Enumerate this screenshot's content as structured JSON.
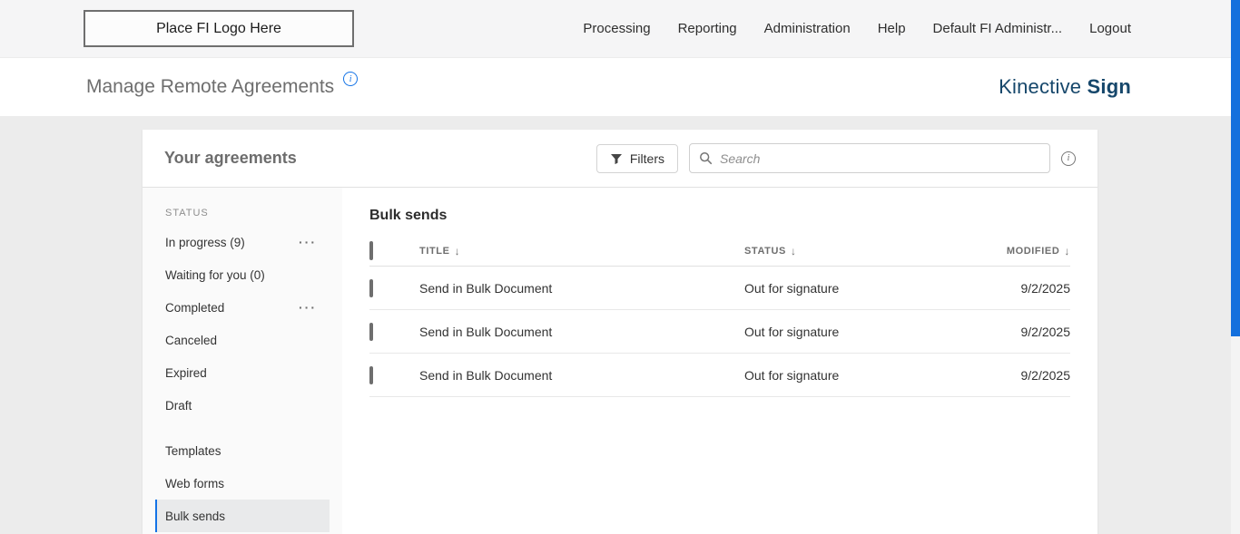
{
  "topnav": {
    "logo_placeholder": "Place FI Logo Here",
    "items": [
      {
        "label": "Processing"
      },
      {
        "label": "Reporting"
      },
      {
        "label": "Administration"
      },
      {
        "label": "Help"
      },
      {
        "label": "Default FI Administr..."
      },
      {
        "label": "Logout"
      }
    ]
  },
  "header": {
    "title": "Manage Remote Agreements",
    "brand": {
      "name": "Kinective",
      "product": "Sign"
    }
  },
  "card": {
    "title": "Your agreements",
    "filters_label": "Filters",
    "search_placeholder": "Search"
  },
  "sidebar": {
    "section_label": "STATUS",
    "status_items": [
      {
        "label": "In progress (9)",
        "has_menu": true
      },
      {
        "label": "Waiting for you (0)",
        "has_menu": false
      },
      {
        "label": "Completed",
        "has_menu": true
      },
      {
        "label": "Canceled",
        "has_menu": false
      },
      {
        "label": "Expired",
        "has_menu": false
      },
      {
        "label": "Draft",
        "has_menu": false
      }
    ],
    "other_items": [
      {
        "label": "Templates",
        "selected": false
      },
      {
        "label": "Web forms",
        "selected": false
      },
      {
        "label": "Bulk sends",
        "selected": true
      }
    ]
  },
  "main": {
    "heading": "Bulk sends",
    "table": {
      "columns": {
        "title": "TITLE",
        "status": "STATUS",
        "modified": "MODIFIED"
      },
      "rows": [
        {
          "title": "Send in Bulk Document",
          "status": "Out for signature",
          "modified": "9/2/2025"
        },
        {
          "title": "Send in Bulk Document",
          "status": "Out for signature",
          "modified": "9/2/2025"
        },
        {
          "title": "Send in Bulk Document",
          "status": "Out for signature",
          "modified": "9/2/2025"
        }
      ]
    }
  },
  "icons": {
    "sort_arrow": "↓",
    "ellipsis_menu": "···",
    "info_glyph": "i"
  },
  "colors": {
    "accent_blue": "#1473e6",
    "brand_navy": "#16476b"
  }
}
